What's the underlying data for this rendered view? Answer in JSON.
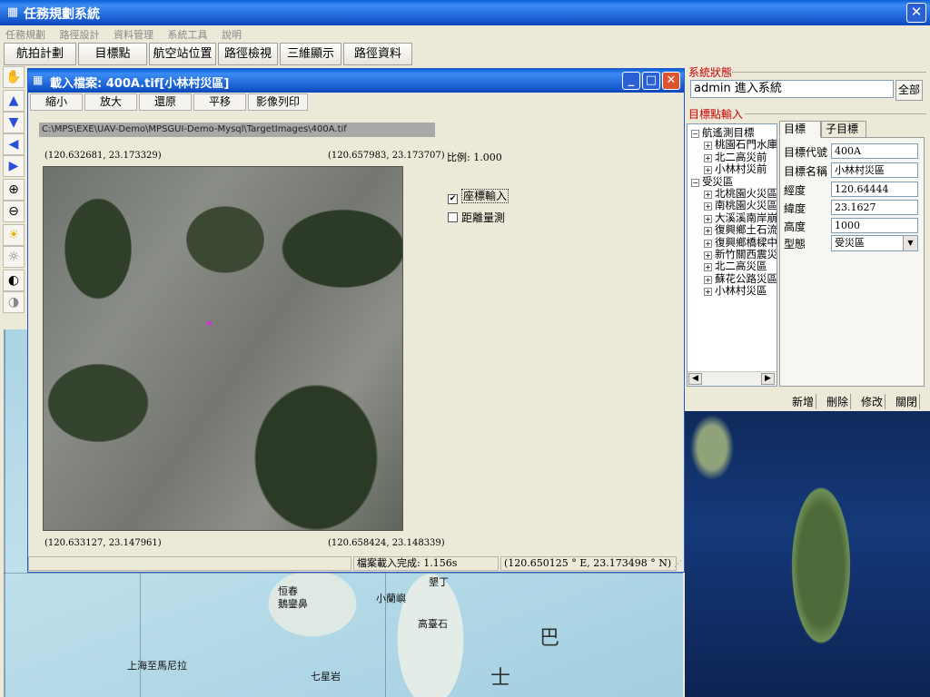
{
  "app": {
    "title": "任務規劃系統"
  },
  "menu": [
    "任務規劃",
    "路徑設計",
    "資料管理",
    "系統工具",
    "說明"
  ],
  "toolbar": [
    "航拍計劃",
    "目標點",
    "航空站位置",
    "路徑檢視",
    "三維顯示",
    "路徑資料"
  ],
  "left_tools": [
    "hand-icon",
    "arrow-up-icon",
    "arrow-down-icon",
    "arrow-left-icon",
    "arrow-right-icon",
    "zoom-in-icon",
    "zoom-out-icon",
    "brightness-up-icon",
    "brightness-down-icon",
    "contrast-up-icon",
    "contrast-down-icon"
  ],
  "map": {
    "labels": [
      "恒春",
      "鵝鑾鼻",
      "墾丁",
      "小蘭嶼",
      "高臺石",
      "七星岩",
      "上海至馬尼拉",
      "巴",
      "士"
    ]
  },
  "child_window": {
    "title": "載入檔案: 400A.tif[小林村災區]",
    "toolbar": [
      "縮小",
      "放大",
      "還原",
      "平移",
      "影像列印"
    ],
    "path": "C:\\MPS\\EXE\\UAV-Demo\\MPSGUI-Demo-Mysql\\TargetImages\\400A.tif",
    "coords": {
      "top_left": "(120.632681, 23.173329)",
      "top_right": "(120.657983, 23.173707)",
      "bottom_left": "(120.633127, 23.147961)",
      "bottom_right": "(120.658424, 23.148339)"
    },
    "scale": "比例: 1.000",
    "checkboxes": [
      {
        "label": "座標輸入",
        "checked": true
      },
      {
        "label": "距離量測",
        "checked": false
      }
    ],
    "status": {
      "load": "檔案載入完成: 1.156s",
      "cursor": "(120.650125 ° E, 23.173498 ° N)"
    }
  },
  "right_panel": {
    "system_status_title": "系統狀態",
    "status_value": "admin 進入系統",
    "all_button": "全部",
    "target_input_title": "目標點輸入",
    "tree": [
      {
        "label": "航遙測目標",
        "level": 0,
        "expander": "−"
      },
      {
        "label": "桃園石門水庫",
        "level": 1,
        "expander": "+"
      },
      {
        "label": "北二高災前",
        "level": 1,
        "expander": "+"
      },
      {
        "label": "小林村災前",
        "level": 1,
        "expander": "+"
      },
      {
        "label": "受災區",
        "level": 0,
        "expander": "−"
      },
      {
        "label": "北桃園火災區",
        "level": 1,
        "expander": "+"
      },
      {
        "label": "南桃園火災區",
        "level": 1,
        "expander": "+"
      },
      {
        "label": "大溪溪南岸崩",
        "level": 1,
        "expander": "+"
      },
      {
        "label": "復興鄉土石流",
        "level": 1,
        "expander": "+"
      },
      {
        "label": "復興鄉橋樑中",
        "level": 1,
        "expander": "+"
      },
      {
        "label": "新竹關西震災",
        "level": 1,
        "expander": "+"
      },
      {
        "label": "北二高災區",
        "level": 1,
        "expander": "+"
      },
      {
        "label": "蘇花公路災區",
        "level": 1,
        "expander": "+"
      },
      {
        "label": "小林村災區",
        "level": 1,
        "expander": "+"
      }
    ],
    "tabs": [
      "目標",
      "子目標"
    ],
    "form": [
      {
        "label": "目標代號",
        "value": "400A"
      },
      {
        "label": "目標名稱",
        "value": "小林村災區"
      },
      {
        "label": "經度",
        "value": "120.64444"
      },
      {
        "label": "緯度",
        "value": "23.1627"
      },
      {
        "label": "高度",
        "value": "1000"
      }
    ],
    "type_label": "型態",
    "type_value": "受災區",
    "actions": [
      "新增",
      "刪除",
      "修改",
      "關閉"
    ]
  }
}
